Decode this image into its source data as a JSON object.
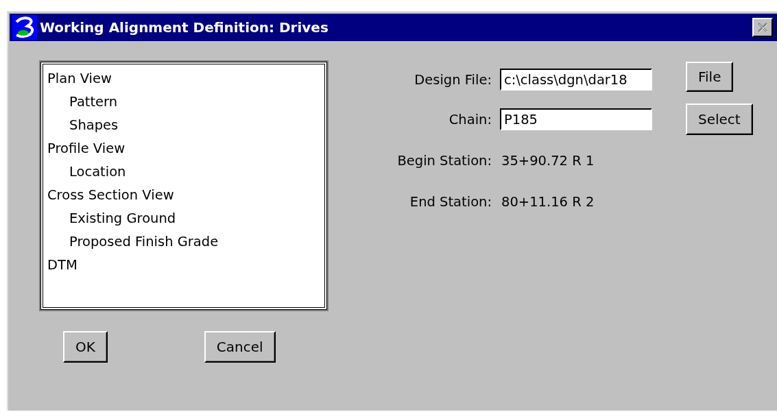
{
  "window": {
    "title": "Working Alignment Definition: Drives",
    "close_button": {
      "disabled": true
    }
  },
  "tree": {
    "items": [
      {
        "label": "Plan View",
        "children": [
          {
            "label": "Pattern"
          },
          {
            "label": "Shapes"
          }
        ]
      },
      {
        "label": "Profile View",
        "children": [
          {
            "label": "Location"
          }
        ]
      },
      {
        "label": "Cross Section View",
        "children": [
          {
            "label": "Existing Ground"
          },
          {
            "label": "Proposed Finish Grade"
          }
        ]
      },
      {
        "label": "DTM"
      }
    ]
  },
  "fields": [
    {
      "kind": "input",
      "label": "Design File:",
      "value": "c:\\class\\dgn\\dar18",
      "button": "File"
    },
    {
      "kind": "input",
      "label": "Chain:",
      "value": "P185",
      "button": "Select"
    },
    {
      "kind": "text",
      "label": "Begin Station:",
      "value": "35+90.72 R 1"
    },
    {
      "kind": "text",
      "label": "End Station:",
      "value": "80+11.16 R 2"
    }
  ],
  "buttons": [
    "OK",
    "Cancel"
  ]
}
